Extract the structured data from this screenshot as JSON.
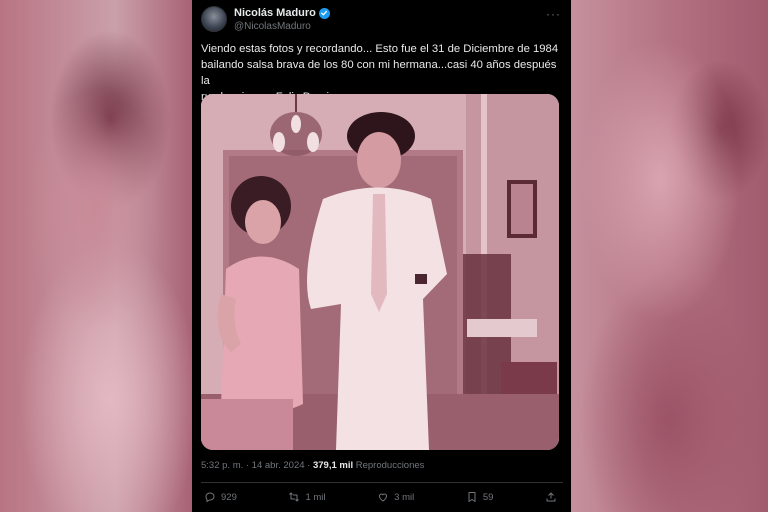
{
  "tweet": {
    "author_name": "Nicolás Maduro",
    "author_handle": "@NicolasMaduro",
    "more_icon": "more-dots-icon",
    "body": "Viendo estas fotos y recordando... Esto fue el 31 de Diciembre de 1984\nbailando salsa brava de los 80 con mi hermana...casi 40 años después la\nrumba sigue... Feliz Domingo...",
    "timestamp": "5:32 p. m. · 14 abr. 2024 ·",
    "views_count": "379,1 mil",
    "views_label": "Reproducciones"
  },
  "actions": {
    "replies": "929",
    "reposts": "1 mil",
    "likes": "3 mil",
    "bookmarks": "59"
  },
  "colors": {
    "background": "#000000",
    "text": "#e7e9ea",
    "muted": "#71767b",
    "verified": "#1d9bf0",
    "photo_tint": "#c99aa4"
  }
}
